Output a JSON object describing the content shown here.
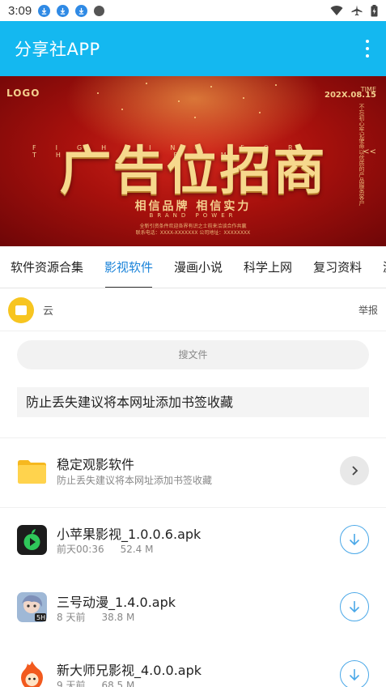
{
  "status_bar": {
    "time": "3:09",
    "left_icons": [
      "download-icon",
      "download-icon",
      "download-icon",
      "circle-icon"
    ],
    "right_icons": [
      "wifi-icon",
      "airplane-icon",
      "battery-icon"
    ]
  },
  "app_bar": {
    "title": "分享社APP",
    "menu_icon": "more-vert-icon",
    "color": "#14b8f0"
  },
  "banner": {
    "logo": "LOGO",
    "time_label": "TIME",
    "date": "202X.08.15",
    "vertical_text": "不忘初心牢记使命以优质的产品服务客户",
    "arrow": "<<",
    "fighting": "FIGHTING FOR THE DREAM",
    "headline": "广告位招商",
    "slogan": "相信品牌 相信实力",
    "brand_power": "BRAND POWER",
    "small_line_1": "全新引资条件欢迎各界有识之士前来洽谈合作共赢",
    "small_line_2": "联系电话：XXXX-XXXXXXX 公司地址：XXXXXXXX"
  },
  "tabs": [
    {
      "label": "软件资源合集",
      "active": false
    },
    {
      "label": "影视软件",
      "active": true
    },
    {
      "label": "漫画小说",
      "active": false
    },
    {
      "label": "科学上网",
      "active": false
    },
    {
      "label": "复习资料",
      "active": false
    },
    {
      "label": "游",
      "active": false
    }
  ],
  "owner": {
    "name": "云",
    "report": "举报",
    "avatar_color": "#f7c520"
  },
  "search": {
    "placeholder": "搜文件"
  },
  "notice": "防止丢失建议将本网址添加书签收藏",
  "folder": {
    "title": "稳定观影软件",
    "subtitle": "防止丢失建议将本网址添加书签收藏",
    "icon": "folder-icon",
    "action_icon": "chevron-right-icon"
  },
  "files": [
    {
      "name": "小苹果影视_1.0.0.6.apk",
      "time": "前天00:36",
      "size": "52.4 M",
      "icon": "apple-app-icon"
    },
    {
      "name": "三号动漫_1.4.0.apk",
      "time": "8 天前",
      "size": "38.8 M",
      "icon": "anime-app-icon"
    },
    {
      "name": "新大师兄影视_4.0.0.apk",
      "time": "9 天前",
      "size": "68.5 M",
      "icon": "fire-app-icon"
    }
  ],
  "colors": {
    "accent": "#1a83d9",
    "download_ring": "#4aa8e8",
    "banner_red": "#a8110d",
    "banner_gold": "#f6d98d"
  }
}
